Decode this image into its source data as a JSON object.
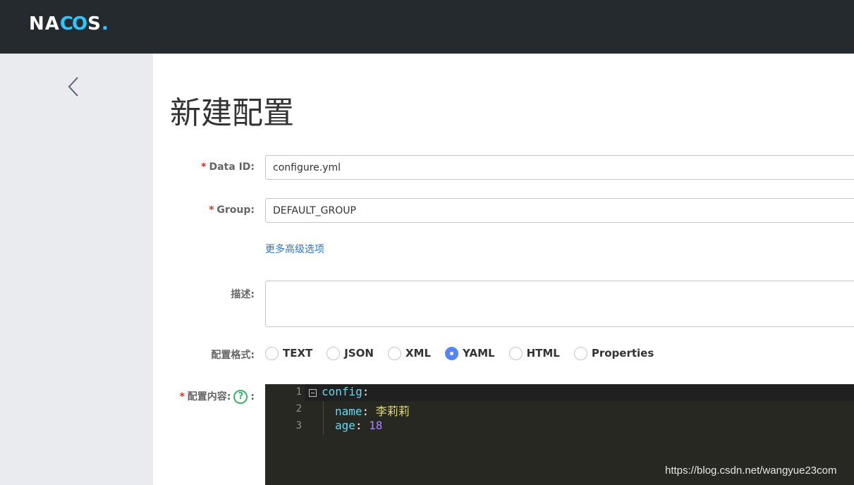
{
  "brand": {
    "logo_na": "NA",
    "logo_co": "CO",
    "logo_s": "S",
    "logo_dot": "."
  },
  "page": {
    "title": "新建配置"
  },
  "form": {
    "data_id": {
      "required_mark": "*",
      "label": "Data ID:",
      "value": "configure.yml"
    },
    "group": {
      "required_mark": "*",
      "label": "Group:",
      "value": "DEFAULT_GROUP"
    },
    "advanced_link": "更多高级选项",
    "description": {
      "label": "描述:",
      "value": ""
    },
    "format": {
      "label": "配置格式:",
      "options": [
        "TEXT",
        "JSON",
        "XML",
        "YAML",
        "HTML",
        "Properties"
      ],
      "selected": "YAML"
    },
    "content": {
      "required_mark": "*",
      "label": "配置内容:",
      "help": "?",
      "colon": ":"
    }
  },
  "editor": {
    "line_numbers": [
      "1",
      "2",
      "3"
    ],
    "lines": [
      {
        "key": "config",
        "sep": ":",
        "value": ""
      },
      {
        "key": "name",
        "sep": ": ",
        "value": "李莉莉"
      },
      {
        "key": "age",
        "sep": ": ",
        "value": "18"
      }
    ],
    "colors": {
      "background": "#272822",
      "key": "#66d9ef",
      "string": "#e6db74",
      "number": "#ae81ff"
    }
  },
  "watermark": "https://blog.csdn.net/wangyue23com",
  "colors": {
    "topbar": "#252a2f",
    "sidebar": "#e9ebef",
    "link": "#2a76cd",
    "required": "#d4341d",
    "radio_checked": "#5584ff",
    "help": "#35b56b"
  }
}
